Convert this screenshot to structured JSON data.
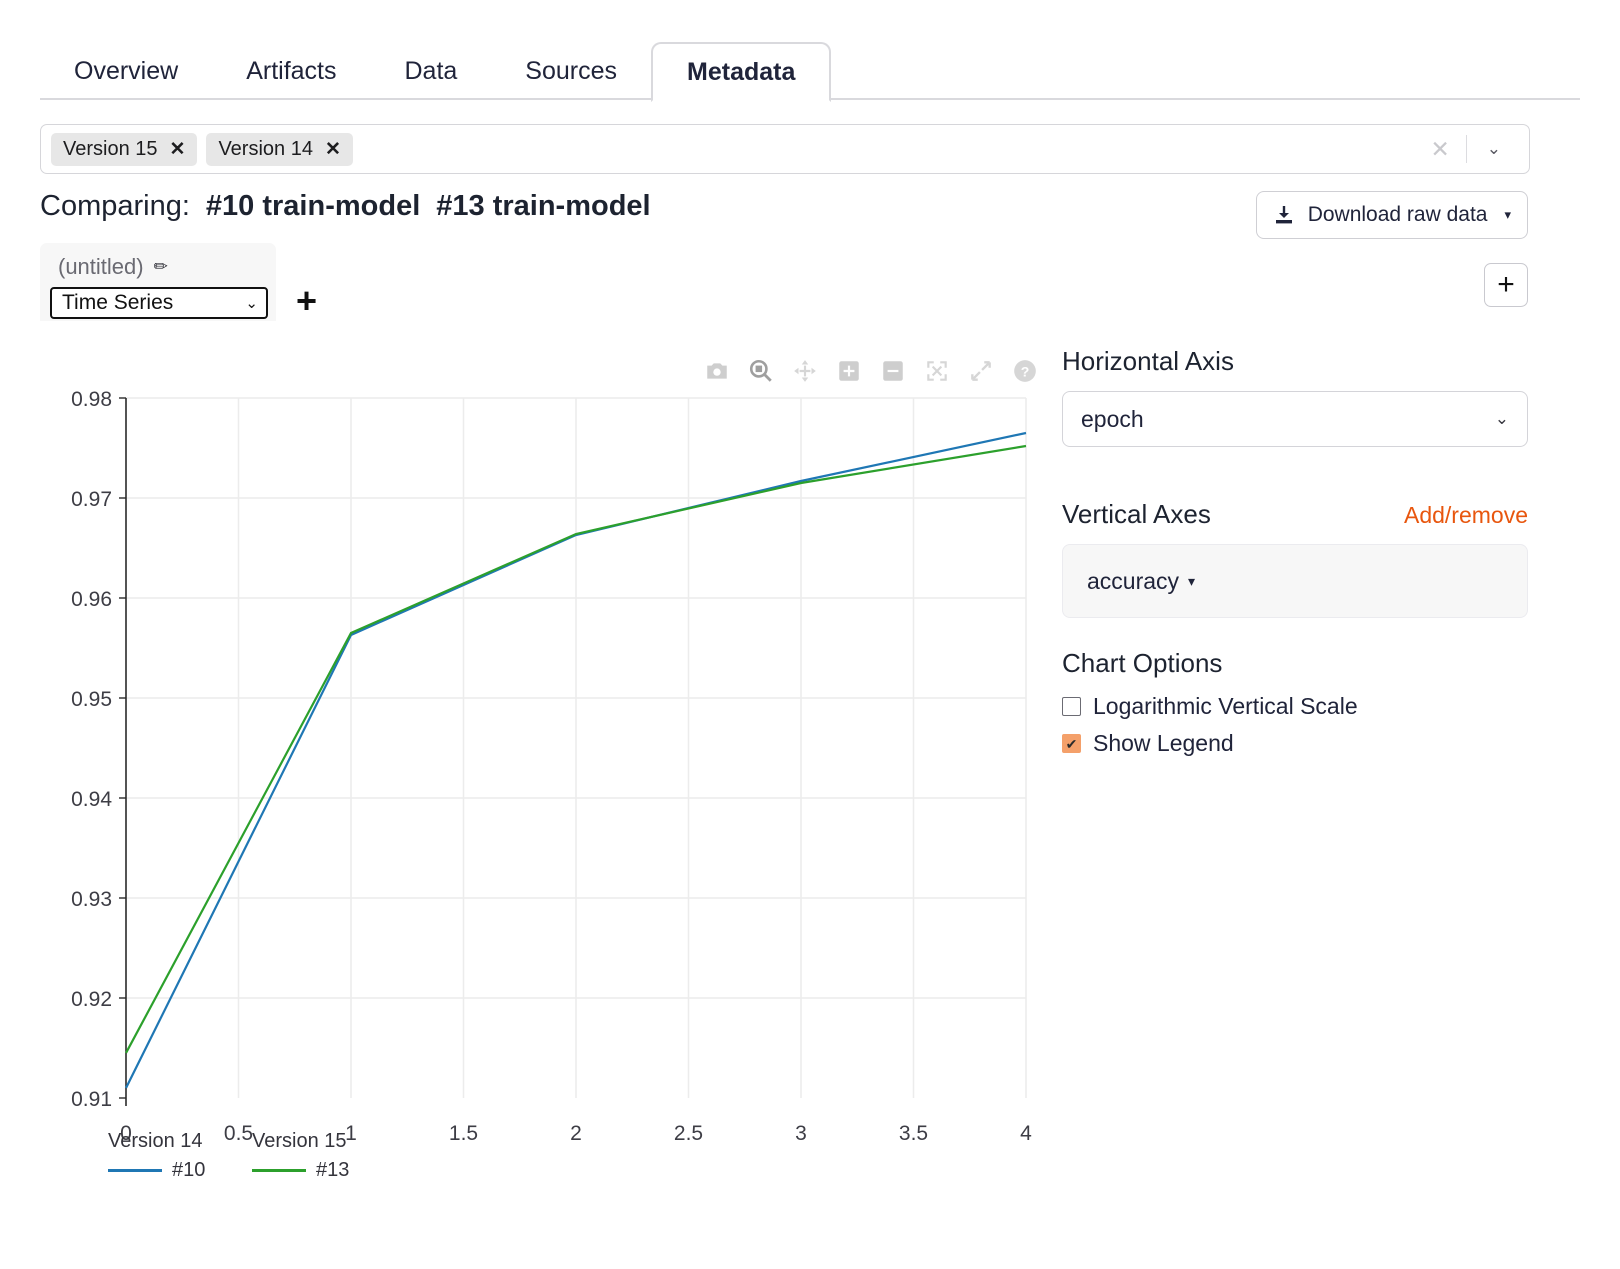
{
  "tabs": [
    {
      "label": "Overview",
      "active": false
    },
    {
      "label": "Artifacts",
      "active": false
    },
    {
      "label": "Data",
      "active": false
    },
    {
      "label": "Sources",
      "active": false
    },
    {
      "label": "Metadata",
      "active": true
    }
  ],
  "chipbar": {
    "chips": [
      {
        "label": "Version 15",
        "close": "✕"
      },
      {
        "label": "Version 14",
        "close": "✕"
      }
    ],
    "clear_icon": "✕",
    "caret_icon": "⌄"
  },
  "comparing": {
    "label": "Comparing:",
    "runs": [
      "#10 train-model",
      "#13 train-model"
    ]
  },
  "download": {
    "label": "Download raw data",
    "icon": "download-icon",
    "caret": "▾"
  },
  "chart_card": {
    "title": "(untitled)",
    "pencil_icon": "✏",
    "chart_type": "Time Series",
    "chart_type_options": [
      "Time Series"
    ],
    "select_caret": "⌄",
    "add_chart_label": "+",
    "add_panel_label": "+"
  },
  "modebar": {
    "icons": [
      "camera-icon",
      "zoom-icon",
      "pan-icon",
      "zoom-in-icon",
      "zoom-out-icon",
      "autoscale-icon",
      "reset-axes-icon",
      "help-icon"
    ]
  },
  "right_panel": {
    "horizontal_axis_title": "Horizontal Axis",
    "horizontal_axis_value": "epoch",
    "horizontal_axis_caret": "⌄",
    "vertical_axes_title": "Vertical Axes",
    "add_remove_label": "Add/remove",
    "vertical_axis_value": "accuracy",
    "vertical_axis_caret": "▾",
    "chart_options_title": "Chart Options",
    "options": [
      {
        "label": "Logarithmic Vertical Scale",
        "checked": false
      },
      {
        "label": "Show Legend",
        "checked": true
      }
    ]
  },
  "colors": {
    "accent_orange": "#e8560e",
    "checkbox_checked": "#f4a06a",
    "series_blue": "#1f77b4",
    "series_green": "#2ca02c",
    "grid": "#ececec"
  },
  "chart_data": {
    "type": "line",
    "title": "",
    "xlabel": "epoch",
    "ylabel": "accuracy",
    "x": [
      0,
      1,
      2,
      3,
      4
    ],
    "xticks": [
      "0",
      "0.5",
      "1",
      "1.5",
      "2",
      "2.5",
      "3",
      "3.5",
      "4"
    ],
    "xtickvals": [
      0,
      0.5,
      1,
      1.5,
      2,
      2.5,
      3,
      3.5,
      4
    ],
    "yticks": [
      "0.91",
      "0.92",
      "0.93",
      "0.94",
      "0.95",
      "0.96",
      "0.97",
      "0.98"
    ],
    "ytickvals": [
      0.91,
      0.92,
      0.93,
      0.94,
      0.95,
      0.96,
      0.97,
      0.98
    ],
    "xlim": [
      0,
      4
    ],
    "ylim": [
      0.91,
      0.98
    ],
    "grid": true,
    "legend_position": "bottom-left",
    "series": [
      {
        "name": "#10",
        "group": "Version 14",
        "color": "#1f77b4",
        "values": [
          0.911,
          0.9563,
          0.9663,
          0.9717,
          0.9765
        ]
      },
      {
        "name": "#13",
        "group": "Version 15",
        "color": "#2ca02c",
        "values": [
          0.9145,
          0.9565,
          0.9664,
          0.9715,
          0.9752
        ]
      }
    ],
    "legend": [
      {
        "group": "Version 14",
        "name": "#10",
        "color": "#1f77b4"
      },
      {
        "group": "Version 15",
        "name": "#13",
        "color": "#2ca02c"
      }
    ]
  }
}
